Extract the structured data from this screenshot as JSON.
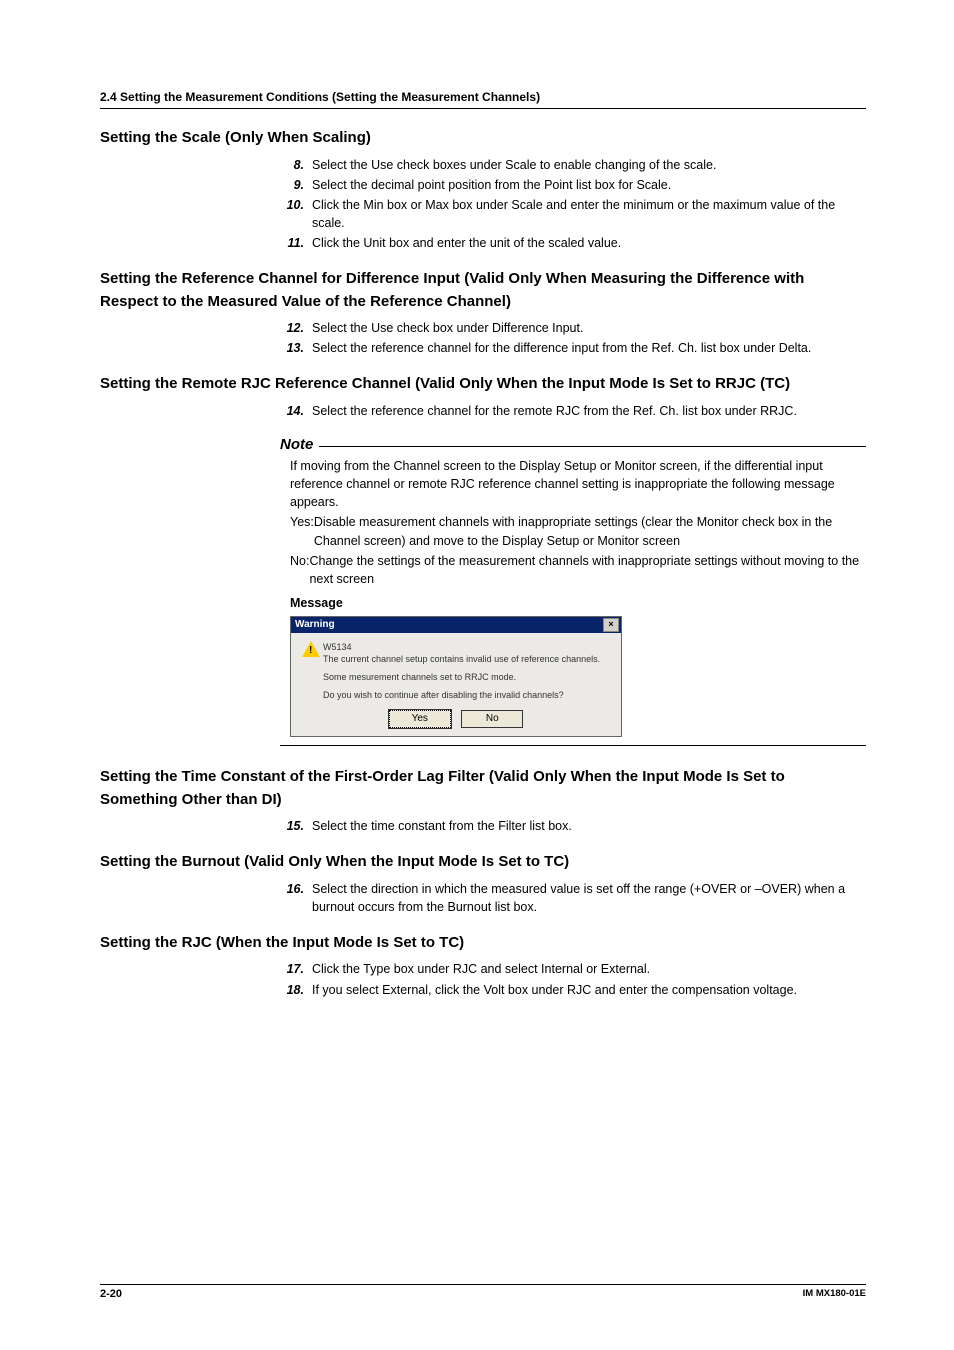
{
  "header": "2.4  Setting the Measurement Conditions (Setting the Measurement Channels)",
  "s1": {
    "title": "Setting the Scale (Only When Scaling)",
    "steps": [
      {
        "n": "8.",
        "t": "Select the Use check boxes under Scale to enable changing of the scale."
      },
      {
        "n": "9.",
        "t": "Select the decimal point position from the Point list box for Scale."
      },
      {
        "n": "10.",
        "t": "Click the Min box or Max box under Scale and enter the minimum or the maximum value of the scale."
      },
      {
        "n": "11.",
        "t": "Click the Unit box and enter the unit of the scaled value."
      }
    ]
  },
  "s2": {
    "title": "Setting the Reference Channel for Difference Input (Valid Only When Measuring the Difference with Respect to the Measured Value of the Reference Channel)",
    "steps": [
      {
        "n": "12.",
        "t": "Select the Use check box under Difference Input."
      },
      {
        "n": "13.",
        "t": "Select the reference channel for the difference input from the Ref. Ch. list box under Delta."
      }
    ]
  },
  "s3": {
    "title": "Setting the Remote RJC Reference Channel (Valid Only When the Input Mode Is Set to RRJC (TC)",
    "steps": [
      {
        "n": "14.",
        "t": "Select the reference channel for the remote RJC from the Ref. Ch. list box under RRJC."
      }
    ]
  },
  "note": {
    "label": "Note",
    "intro": "If moving from the Channel screen to the Display Setup or Monitor screen, if the differential input reference channel or remote RJC reference channel setting is inappropriate the following message appears.",
    "yes_key": "Yes: ",
    "yes": "Disable measurement channels with inappropriate settings (clear the Monitor check box in the Channel screen) and move to the Display Setup or Monitor screen",
    "no_key": "No: ",
    "no": "Change the settings of the measurement channels with inappropriate settings without moving to the next screen",
    "msg_label": "Message"
  },
  "dialog": {
    "title": "Warning",
    "close": "×",
    "code": "W5134",
    "line1": "The current channel setup contains invalid use of reference channels.",
    "line2": "Some mesurement channels set to RRJC mode.",
    "line3": "Do you wish to continue after disabling the invalid channels?",
    "yes": "Yes",
    "no": "No"
  },
  "s4": {
    "title": "Setting the Time Constant of the First-Order Lag Filter (Valid Only When the Input Mode Is Set to Something Other than DI)",
    "steps": [
      {
        "n": "15.",
        "t": "Select the time constant from the Filter list box."
      }
    ]
  },
  "s5": {
    "title": "Setting the Burnout (Valid Only When the Input Mode Is Set to TC)",
    "steps": [
      {
        "n": "16.",
        "t": "Select the direction in which the measured value is set off the range (+OVER or –OVER) when a burnout occurs from the Burnout list box."
      }
    ]
  },
  "s6": {
    "title": "Setting the RJC (When the Input Mode Is Set to TC)",
    "steps": [
      {
        "n": "17.",
        "t": "Click the Type box under RJC and select Internal or External."
      },
      {
        "n": "18.",
        "t": "If you select External, click the Volt box under RJC and enter the compensation voltage."
      }
    ]
  },
  "footer": {
    "page": "2-20",
    "imprint": "IM MX180-01E"
  }
}
